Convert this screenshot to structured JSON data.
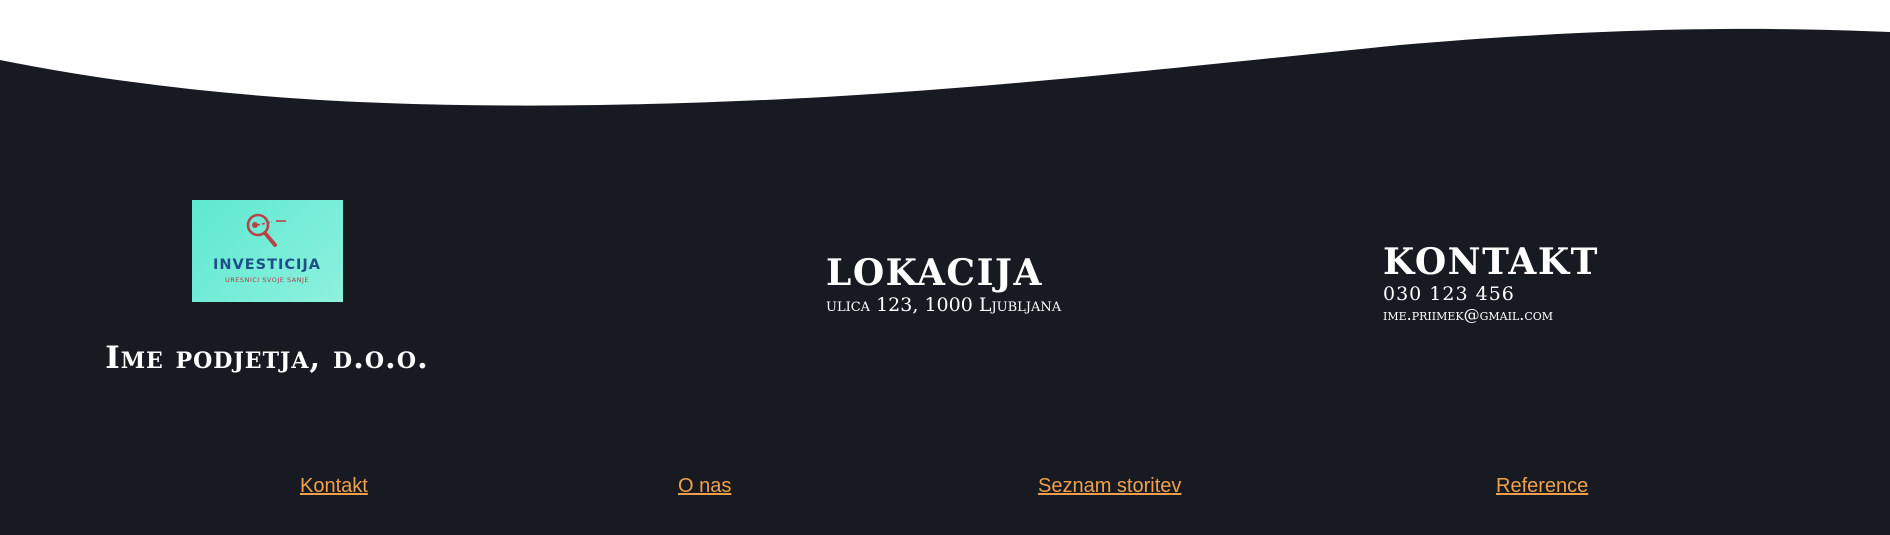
{
  "colors": {
    "footer_bg": "#171b21",
    "link": "#f0a04b",
    "text": "#ffffff",
    "logo_bg": "#6ceccf"
  },
  "logo": {
    "icon": "magnifier-key-icon",
    "wordmark": "INVESTICIJA",
    "tagline": "URESNICI SVOJE SANJE"
  },
  "company_name": "Ime podjetja, d.o.o.",
  "location": {
    "title": "LOKACIJA",
    "address": "ulica 123, 1000 Ljubljana"
  },
  "contact": {
    "title": "KONTAKT",
    "phone": "030 123 456",
    "email": "ime.priimek@gmail.com"
  },
  "nav": {
    "kontakt": "Kontakt",
    "o_nas": "O nas",
    "seznam_storitev": "Seznam storitev",
    "reference": "Reference"
  }
}
